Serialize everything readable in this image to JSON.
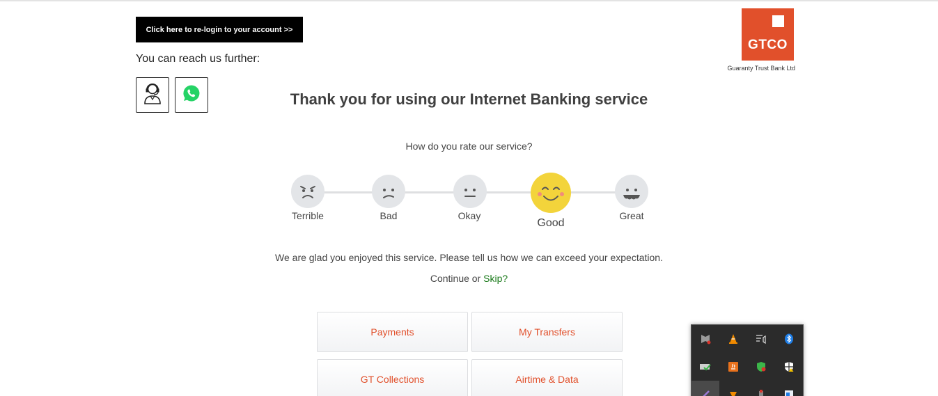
{
  "relogin_label": "Click here to re-login to your account >>",
  "reach_text": "You can reach us further:",
  "contacts": [
    {
      "icon": "customer-agent-icon"
    },
    {
      "icon": "whatsapp-icon"
    }
  ],
  "logo": {
    "text": "GTCO",
    "subtitle": "Guaranty Trust Bank Ltd"
  },
  "title": "Thank you for using our Internet Banking service",
  "rating": {
    "question": "How do you rate our service?",
    "options": [
      "Terrible",
      "Bad",
      "Okay",
      "Good",
      "Great"
    ],
    "selected": "Good"
  },
  "feedback_text": "We are glad you enjoyed this service. Please tell us how we can exceed your expectation.",
  "continue_text": "Continue or ",
  "skip_text": "Skip?",
  "tiles": [
    "Payments",
    "My Transfers",
    "GT Collections",
    "Airtime & Data"
  ],
  "tray_icons": [
    "mcafee-icon",
    "vlc-icon",
    "playlist-icon",
    "bluetooth-icon",
    "network-check-icon",
    "java-icon",
    "shield-update-icon",
    "security-center-icon",
    "pen-icon",
    "vlc-small-icon",
    "usb-device-icon",
    "document-icon"
  ],
  "colors": {
    "brand": "#e1502b",
    "selected_face": "#f3d43b",
    "skip": "#1a7a1a"
  }
}
